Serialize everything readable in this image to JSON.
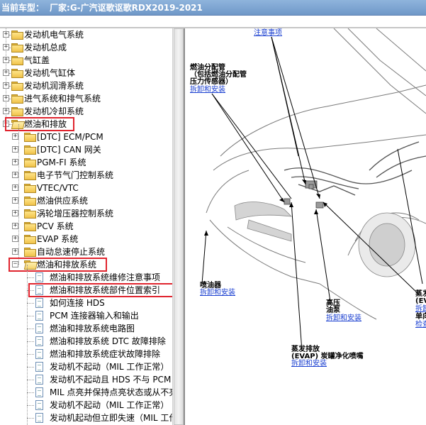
{
  "titlebar": {
    "prefix": "当前车型：",
    "model": "厂家:G-广汽讴歌讴歌RDX2019-2021"
  },
  "tree": {
    "level1": [
      {
        "label": "发动机电气系统"
      },
      {
        "label": "发动机总成"
      },
      {
        "label": "气缸盖"
      },
      {
        "label": "发动机气缸体"
      },
      {
        "label": "发动机润滑系统"
      },
      {
        "label": "进气系统和排气系统"
      },
      {
        "label": "发动机冷却系统"
      },
      {
        "label": "燃油和排放"
      }
    ],
    "level2": [
      {
        "label": "[DTC] ECM/PCM"
      },
      {
        "label": "[DTC] CAN 网关"
      },
      {
        "label": "PGM-FI 系统"
      },
      {
        "label": "电子节气门控制系统"
      },
      {
        "label": "VTEC/VTC"
      },
      {
        "label": "燃油供应系统"
      },
      {
        "label": "涡轮增压器控制系统"
      },
      {
        "label": "PCV 系统"
      },
      {
        "label": "EVAP 系统"
      },
      {
        "label": "自动怠速停止系统"
      },
      {
        "label": "燃油和排放系统"
      }
    ],
    "level3": [
      {
        "label": "燃油和排放系统维修注意事项"
      },
      {
        "label": "燃油和排放系统部件位置索引"
      },
      {
        "label": "如何连接 HDS"
      },
      {
        "label": "PCM 连接器输入和输出"
      },
      {
        "label": "燃油和排放系统电路图"
      },
      {
        "label": "燃油和排放系统 DTC 故障排除"
      },
      {
        "label": "燃油和排放系统症状故障排除"
      },
      {
        "label": "发动机不起动（MIL 工作正常）"
      },
      {
        "label": "发动机不起动且 HDS 不与 PCM 通信"
      },
      {
        "label": "MIL 点亮并保持点亮状态或从不亮"
      },
      {
        "label": "发动机不起动（MIL 工作正常）"
      },
      {
        "label": "发动机起动但立即失速（MIL 工作正常）"
      }
    ]
  },
  "diagram": {
    "note_link": "注意事项",
    "fuel_rail_title": "燃油分配管",
    "fuel_rail_sub1": "（包括燃油分配管",
    "fuel_rail_sub2": "压力传感器）",
    "fuel_rail_link": "拆卸和安装",
    "injector_title": "喷油器",
    "injector_link": "拆卸和安装",
    "pump_title1": "高压",
    "pump_title2": "油泵",
    "pump_link": "拆卸和安装",
    "evap_title1": "蒸发排放",
    "evap_title2": "(EVAP) 炭罐净化喷嘴",
    "evap_link": "拆卸和安装",
    "right_title1": "蒸发",
    "right_title2": "(EV",
    "right_link1": "拆卸",
    "right_title3": "单向",
    "right_link2": "检查"
  },
  "colors": {
    "highlight": "#e0242e",
    "link": "#1a3fd0"
  }
}
